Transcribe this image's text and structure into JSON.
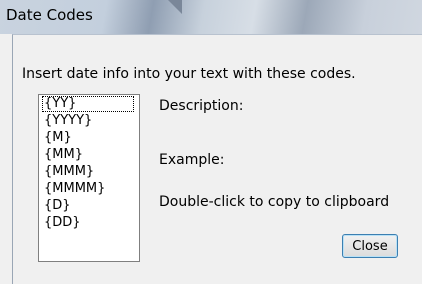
{
  "window": {
    "title": "Date Codes"
  },
  "instruction": "Insert date info into your text with these codes.",
  "codes": [
    "{YY}",
    "{YYYY}",
    "{M}",
    "{MM}",
    "{MMM}",
    "{MMMM}",
    "{D}",
    "{DD}"
  ],
  "selected_index": 0,
  "description_label": "Description:",
  "example_label": "Example:",
  "hint": "Double-click to copy to clipboard",
  "close_label": "Close"
}
